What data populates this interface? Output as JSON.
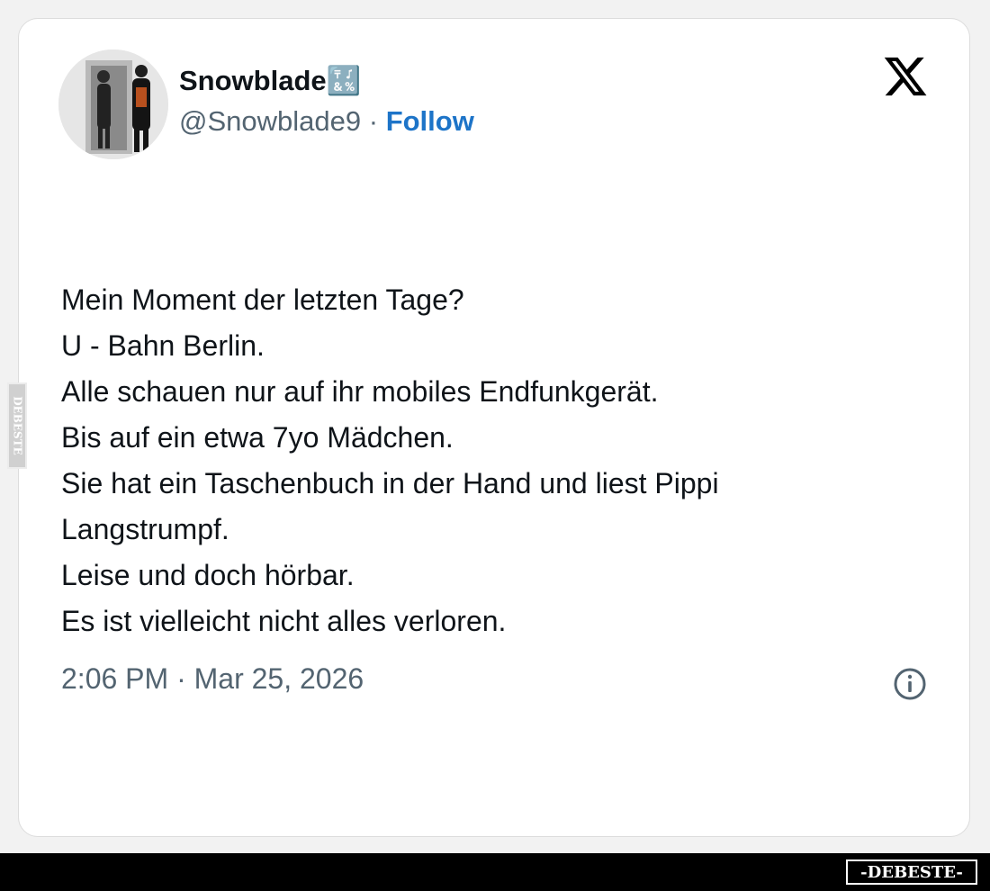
{
  "tweet": {
    "author": {
      "display_name": "Snowblade🔣",
      "handle": "@Snowblade9",
      "separator": "·",
      "follow_label": "Follow"
    },
    "text_lines": [
      "Mein Moment der letzten Tage?",
      "U - Bahn Berlin.",
      "Alle schauen nur auf ihr mobiles Endfunkgerät.",
      "Bis auf ein etwa 7yo Mädchen.",
      "Sie hat ein Taschenbuch in der Hand und liest Pippi",
      "Langstrumpf.",
      "Leise und doch hörbar.",
      "Es ist vielleicht nicht alles verloren."
    ],
    "timestamp": "2:06 PM · Mar 25, 2026"
  },
  "icons": {
    "platform": "x-logo-icon",
    "info": "info-icon"
  },
  "watermark": {
    "brand": "-DEBESTE-",
    "side_text": "DEBESTE"
  },
  "colors": {
    "text": "#0f1419",
    "secondary_text": "#536471",
    "follow_link": "#1d74c8",
    "card_background": "#ffffff",
    "footer_bar": "#000000"
  }
}
